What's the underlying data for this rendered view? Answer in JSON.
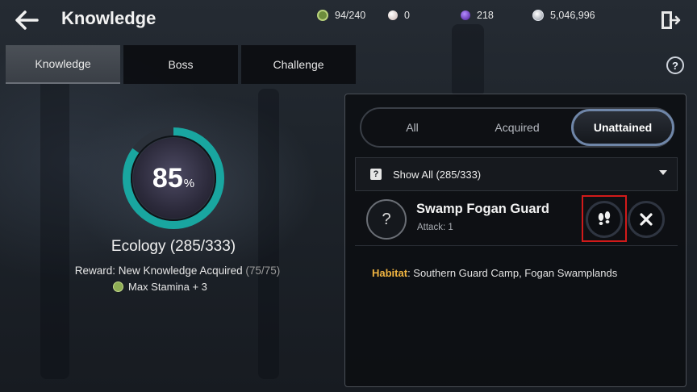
{
  "header": {
    "title": "Knowledge",
    "resources": [
      {
        "icon": "stamina-potion-icon",
        "value": "94/240",
        "color": "#8fae55"
      },
      {
        "icon": "pearl-icon",
        "value": "0",
        "color": "#e8d9d6"
      },
      {
        "icon": "purple-gem-icon",
        "value": "218",
        "color": "#7a3fd1"
      },
      {
        "icon": "silver-coin-icon",
        "value": "5,046,996",
        "color": "#c9ced6"
      }
    ]
  },
  "tabs": [
    {
      "label": "Knowledge",
      "active": true
    },
    {
      "label": "Boss",
      "active": false
    },
    {
      "label": "Challenge",
      "active": false
    }
  ],
  "help": {
    "label": "?"
  },
  "progress": {
    "percent": "85",
    "unit": "%",
    "fraction": 0.85,
    "category": "Ecology (285/333)",
    "reward_label": "Reward: New Knowledge Acquired",
    "reward_count": "(75/75)",
    "bonus": "Max Stamina + 3",
    "ring_color": "#19a6a0"
  },
  "filters": [
    {
      "label": "All",
      "selected": false
    },
    {
      "label": "Acquired",
      "selected": false
    },
    {
      "label": "Unattained",
      "selected": true
    }
  ],
  "dropdown": {
    "icon": "?",
    "label": "Show All (285/333)"
  },
  "entry": {
    "icon": "?",
    "name": "Swamp Fogan Guard",
    "sub": "Attack: 1",
    "habitat_key": "Habitat",
    "habitat_value": ": Southern Guard Camp, Fogan Swamplands"
  },
  "colors": {
    "accent_highlight": "#d11a1a",
    "selected_border": "#6f86a8",
    "habitat_key": "#f0b441"
  }
}
